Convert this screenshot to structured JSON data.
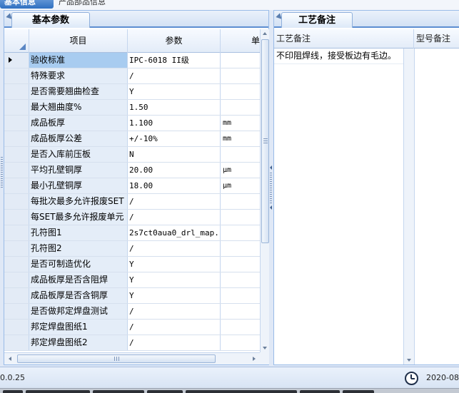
{
  "top_tabs": [
    {
      "label": "基本信息"
    },
    {
      "label": "产品部品信息"
    }
  ],
  "left_panel": {
    "tab_label": "基本参数",
    "columns": [
      "项目",
      "参数",
      "单"
    ],
    "rows": [
      {
        "item": "验收标准",
        "param": "IPC-6018 II级",
        "unit": ""
      },
      {
        "item": "特殊要求",
        "param": "/",
        "unit": ""
      },
      {
        "item": "是否需要翘曲检查",
        "param": "Y",
        "unit": ""
      },
      {
        "item": "最大翘曲度%",
        "param": "1.50",
        "unit": ""
      },
      {
        "item": "成品板厚",
        "param": "1.100",
        "unit": "mm"
      },
      {
        "item": "成品板厚公差",
        "param": "+/-10%",
        "unit": "mm"
      },
      {
        "item": "是否入库前压板",
        "param": "N",
        "unit": ""
      },
      {
        "item": "平均孔壁铜厚",
        "param": "20.00",
        "unit": "μm"
      },
      {
        "item": "最小孔壁铜厚",
        "param": "18.00",
        "unit": "μm"
      },
      {
        "item": "每批次最多允许报废SET",
        "param": "/",
        "unit": ""
      },
      {
        "item": "每SET最多允许报废单元",
        "param": "/",
        "unit": ""
      },
      {
        "item": "孔符图1",
        "param": "2s7ct0aua0_drl_map...",
        "unit": ""
      },
      {
        "item": "孔符图2",
        "param": "/",
        "unit": ""
      },
      {
        "item": "是否可制造优化",
        "param": "Y",
        "unit": ""
      },
      {
        "item": "成品板厚是否含阻焊",
        "param": "Y",
        "unit": ""
      },
      {
        "item": "成品板厚是否含铜厚",
        "param": "Y",
        "unit": ""
      },
      {
        "item": "是否做邦定焊盘测试",
        "param": "/",
        "unit": ""
      },
      {
        "item": "邦定焊盘图纸1",
        "param": "/",
        "unit": ""
      },
      {
        "item": "邦定焊盘图纸2",
        "param": "/",
        "unit": ""
      }
    ]
  },
  "right_panel": {
    "tab_label": "工艺备注",
    "columns": [
      "工艺备注",
      "型号备注"
    ],
    "rows": [
      {
        "remark": "不印阻焊线，接受板边有毛边。",
        "model_remark": ""
      }
    ]
  },
  "status_bar": {
    "version": "0.0.25",
    "date": "2020-08-"
  }
}
